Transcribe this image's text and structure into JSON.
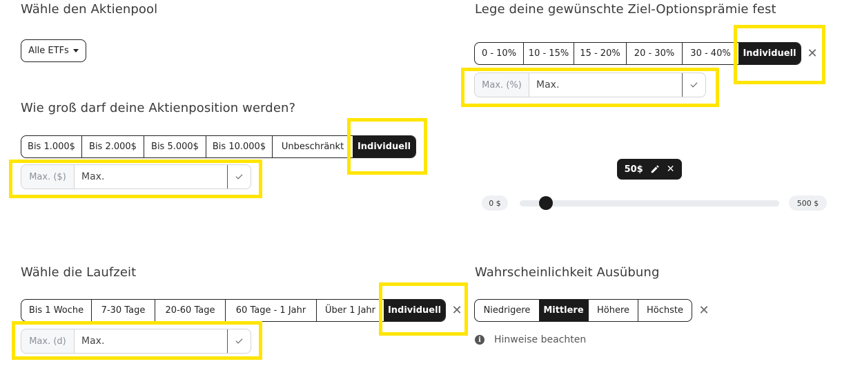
{
  "pool": {
    "heading": "Wähle den Aktienpool",
    "dropdown_label": "Alle ETFs"
  },
  "premium": {
    "heading": "Lege deine gewünschte Ziel-Optionsprämie fest",
    "options": [
      "0 - 10%",
      "10 - 15%",
      "15 - 20%",
      "20 - 30%",
      "30 - 40%",
      "Individuell"
    ],
    "active": "Individuell",
    "input_prefix": "Max. (%)",
    "input_placeholder": "Max."
  },
  "position": {
    "heading": "Wie groß darf deine Aktienposition werden?",
    "options": [
      "Bis 1.000$",
      "Bis 2.000$",
      "Bis 5.000$",
      "Bis 10.000$",
      "Unbeschränkt",
      "Individuell"
    ],
    "active": "Individuell",
    "input_prefix": "Max. ($)",
    "input_placeholder": "Max."
  },
  "slider": {
    "tooltip_value": "50$",
    "min_label": "0 $",
    "max_label": "500 $",
    "value": 50,
    "min": 0,
    "max": 500
  },
  "duration": {
    "heading": "Wähle die Laufzeit",
    "options": [
      "Bis 1 Woche",
      "7-30 Tage",
      "20-60 Tage",
      "60 Tage - 1 Jahr",
      "Über 1 Jahr",
      "Individuell"
    ],
    "active": "Individuell",
    "input_prefix": "Max. (d)",
    "input_placeholder": "Max."
  },
  "probability": {
    "heading": "Wahrscheinlichkeit Ausübung",
    "options": [
      "Niedrigere",
      "Mittlere",
      "Höhere",
      "Höchste"
    ],
    "active": "Mittlere",
    "hint": "Hinweise beachten"
  },
  "icons": {
    "close": "close-icon",
    "check": "check-icon",
    "pencil": "pencil-icon",
    "info": "info-icon",
    "caret": "caret-down-icon"
  },
  "colors": {
    "highlight": "#ffe500",
    "active_bg": "#1b1b1b"
  }
}
